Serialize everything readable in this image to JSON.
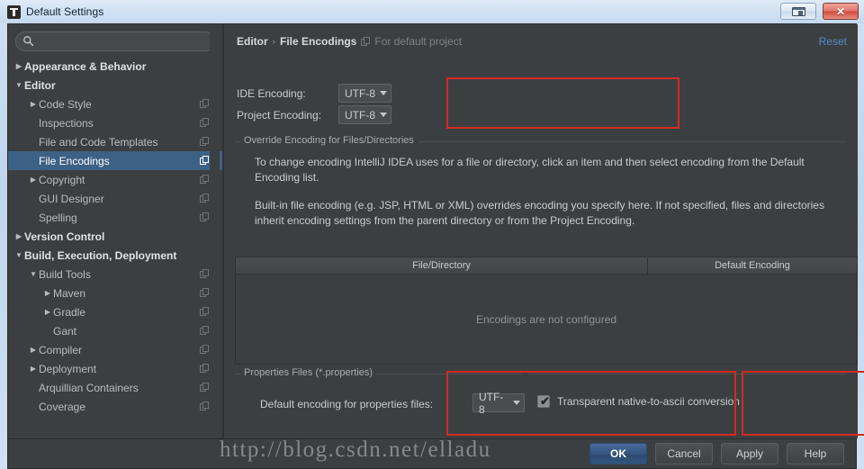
{
  "window": {
    "title": "Default Settings",
    "app_icon": "intellij-idea-icon",
    "restore_button": "restore-window-button",
    "close_button": "close-window-button",
    "close_glyph": "✕"
  },
  "search": {
    "value": "",
    "placeholder": "",
    "icon": "search-icon"
  },
  "sidebar": {
    "items": [
      {
        "label": "Appearance & Behavior",
        "indent": 0,
        "arrow": "▶",
        "bold": true,
        "selected": false,
        "copy_icon": false
      },
      {
        "label": "Editor",
        "indent": 0,
        "arrow": "▼",
        "bold": true,
        "selected": false,
        "copy_icon": false
      },
      {
        "label": "Code Style",
        "indent": 1,
        "arrow": "▶",
        "bold": false,
        "selected": false,
        "copy_icon": true
      },
      {
        "label": "Inspections",
        "indent": 1,
        "arrow": "",
        "bold": false,
        "selected": false,
        "copy_icon": true
      },
      {
        "label": "File and Code Templates",
        "indent": 1,
        "arrow": "",
        "bold": false,
        "selected": false,
        "copy_icon": true
      },
      {
        "label": "File Encodings",
        "indent": 1,
        "arrow": "",
        "bold": false,
        "selected": true,
        "copy_icon": true
      },
      {
        "label": "Copyright",
        "indent": 1,
        "arrow": "▶",
        "bold": false,
        "selected": false,
        "copy_icon": true
      },
      {
        "label": "GUI Designer",
        "indent": 1,
        "arrow": "",
        "bold": false,
        "selected": false,
        "copy_icon": true
      },
      {
        "label": "Spelling",
        "indent": 1,
        "arrow": "",
        "bold": false,
        "selected": false,
        "copy_icon": true
      },
      {
        "label": "Version Control",
        "indent": 0,
        "arrow": "▶",
        "bold": true,
        "selected": false,
        "copy_icon": false
      },
      {
        "label": "Build, Execution, Deployment",
        "indent": 0,
        "arrow": "▼",
        "bold": true,
        "selected": false,
        "copy_icon": false
      },
      {
        "label": "Build Tools",
        "indent": 1,
        "arrow": "▼",
        "bold": false,
        "selected": false,
        "copy_icon": true
      },
      {
        "label": "Maven",
        "indent": 2,
        "arrow": "▶",
        "bold": false,
        "selected": false,
        "copy_icon": true
      },
      {
        "label": "Gradle",
        "indent": 2,
        "arrow": "▶",
        "bold": false,
        "selected": false,
        "copy_icon": true
      },
      {
        "label": "Gant",
        "indent": 2,
        "arrow": "",
        "bold": false,
        "selected": false,
        "copy_icon": true
      },
      {
        "label": "Compiler",
        "indent": 1,
        "arrow": "▶",
        "bold": false,
        "selected": false,
        "copy_icon": true
      },
      {
        "label": "Deployment",
        "indent": 1,
        "arrow": "▶",
        "bold": false,
        "selected": false,
        "copy_icon": true
      },
      {
        "label": "Arquillian Containers",
        "indent": 1,
        "arrow": "",
        "bold": false,
        "selected": false,
        "copy_icon": true
      },
      {
        "label": "Coverage",
        "indent": 1,
        "arrow": "",
        "bold": false,
        "selected": false,
        "copy_icon": true
      }
    ]
  },
  "breadcrumb": {
    "parent": "Editor",
    "separator": "›",
    "current": "File Encodings",
    "note": "For default project",
    "note_icon": "copy-icon"
  },
  "reset": {
    "label": "Reset"
  },
  "encoding": {
    "ide_label": "IDE Encoding:",
    "ide_value": "UTF-8",
    "project_label": "Project Encoding:",
    "project_value": "UTF-8"
  },
  "override": {
    "legend": "Override Encoding for Files/Directories",
    "paragraph1": "To change encoding IntelliJ IDEA uses for a file or directory, click an item and then select encoding from the Default Encoding list.",
    "paragraph2": "Built-in file encoding (e.g. JSP, HTML or XML) overrides encoding you specify here. If not specified, files and directories inherit encoding settings from the parent directory or from the Project Encoding."
  },
  "table": {
    "columns": [
      "File/Directory",
      "Default Encoding"
    ],
    "empty_message": "Encodings are not configured",
    "rows": []
  },
  "properties": {
    "legend": "Properties Files (*.properties)",
    "label": "Default encoding for properties files:",
    "value": "UTF-8"
  },
  "ascii": {
    "checkbox_label": "Transparent native-to-ascii conversion",
    "checked": true,
    "tick": "✔"
  },
  "buttons": {
    "ok": "OK",
    "cancel": "Cancel",
    "apply": "Apply",
    "help": "Help"
  },
  "watermark": {
    "text": "http://blog.csdn.net/elladu"
  },
  "colors": {
    "accent_selection": "#3d6185",
    "link": "#508cc8",
    "annotation": "#d42a22",
    "panel_bg": "#3c3f41",
    "titlebar_bg": "#cfe0f2"
  }
}
